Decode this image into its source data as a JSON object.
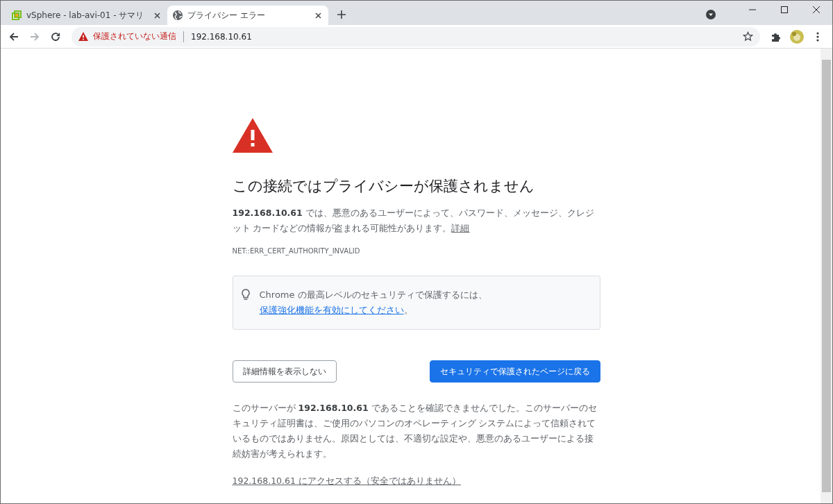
{
  "tabs": [
    {
      "title": "vSphere - lab-avi-01 - サマリ",
      "selected": false
    },
    {
      "title": "プライバシー エラー",
      "selected": true
    }
  ],
  "address_bar": {
    "security_label": "保護されていない通信",
    "url": "192.168.10.61"
  },
  "page": {
    "heading": "この接続ではプライバシーが保護されません",
    "intro": "**192.168.10.61** では、悪意のあるユーザーによって、パスワード、メッセージ、クレジット カードなどの情報が盗まれる可能性があります。",
    "details_link": "詳細",
    "error_code": "NET::ERR_CERT_AUTHORITY_INVALID",
    "tip": {
      "text": "Chrome の最高レベルのセキュリティで保護するには、",
      "link": "保護強化機能を有効にしてください",
      "end": "。"
    },
    "buttons": [
      {
        "label": "詳細情報を表示しない",
        "kind": "secondary"
      },
      {
        "label": "セキュリティで保護されたページに戻る",
        "kind": "primary"
      }
    ],
    "details": "このサーバーが **192.168.10.61** であることを確認できませんでした。このサーバーのセキュリティ証明書は、ご使用のパソコンのオペレーティング システムによって信頼されているものではありません。原因としては、不適切な設定や、悪意のあるユーザーによる接続妨害が考えられます。",
    "proceed_link": "192.168.10.61 にアクセスする（安全ではありません）"
  }
}
